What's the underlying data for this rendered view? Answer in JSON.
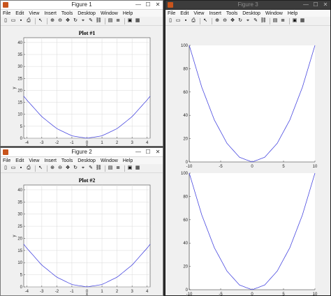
{
  "figure1": {
    "title": "Figure 1",
    "menu": [
      "File",
      "Edit",
      "View",
      "Insert",
      "Tools",
      "Desktop",
      "Window",
      "Help"
    ],
    "plot": {
      "title": "Plot #1",
      "xlabel": "x",
      "ylabel": "y",
      "xticks": [
        "-4",
        "-3",
        "-2",
        "-1",
        "0",
        "1",
        "2",
        "3",
        "4"
      ],
      "yticks": [
        "0",
        "5",
        "10",
        "15",
        "20",
        "25",
        "30",
        "35",
        "40"
      ]
    }
  },
  "figure2": {
    "title": "Figure 2",
    "menu": [
      "File",
      "Edit",
      "View",
      "Insert",
      "Tools",
      "Desktop",
      "Window",
      "Help"
    ],
    "plot": {
      "title": "Plot #2",
      "xlabel": "x",
      "ylabel": "y",
      "xticks": [
        "-4",
        "-3",
        "-2",
        "-1",
        "0",
        "1",
        "2",
        "3",
        "4"
      ],
      "yticks": [
        "0",
        "5",
        "10",
        "15",
        "20",
        "25",
        "30",
        "35",
        "40"
      ]
    }
  },
  "figure3": {
    "title": "Figure 3",
    "menu": [
      "File",
      "Edit",
      "View",
      "Insert",
      "Tools",
      "Desktop",
      "Window",
      "Help"
    ],
    "plots": [
      {
        "xticks": [
          "-10",
          "-5",
          "0",
          "5",
          "10"
        ],
        "yticks": [
          "0",
          "20",
          "40",
          "60",
          "80",
          "100"
        ]
      },
      {
        "xticks": [
          "-10",
          "-5",
          "0",
          "5",
          "10"
        ],
        "yticks": [
          "0",
          "20",
          "40",
          "60",
          "80",
          "100"
        ]
      }
    ]
  },
  "window_controls": {
    "minimize": "—",
    "maximize": "☐",
    "close": "✕"
  },
  "toolbar_icons": [
    "new-file-icon",
    "open-icon",
    "save-icon",
    "print-icon",
    "pointer-icon",
    "zoom-in-icon",
    "zoom-out-icon",
    "pan-icon",
    "rotate-icon",
    "data-cursor-icon",
    "brush-icon",
    "link-icon",
    "colorbar-icon",
    "legend-icon",
    "hide-plot-tools-icon",
    "show-plot-tools-icon"
  ],
  "colors": {
    "line": "#4a4ae0",
    "grid": "#d8d8d8"
  },
  "chart_data": [
    {
      "type": "line",
      "title": "Plot #1",
      "xlabel": "x",
      "ylabel": "y",
      "xlim": [
        -4.2,
        4.2
      ],
      "ylim": [
        0,
        42
      ],
      "grid": true,
      "series": [
        {
          "x": [
            -4.2,
            -4,
            -3,
            -2,
            -1,
            0,
            1,
            2,
            3,
            4,
            4.2
          ],
          "y": [
            17.6,
            16,
            9,
            4,
            1,
            0,
            1,
            4,
            9,
            16,
            17.6
          ]
        }
      ]
    },
    {
      "type": "line",
      "title": "Plot #2",
      "xlabel": "x",
      "ylabel": "y",
      "xlim": [
        -4.2,
        4.2
      ],
      "ylim": [
        0,
        42
      ],
      "grid": true,
      "series": [
        {
          "x": [
            -4.2,
            -4,
            -3,
            -2,
            -1,
            0,
            1,
            2,
            3,
            4,
            4.2
          ],
          "y": [
            17.6,
            16,
            9,
            4,
            1,
            0,
            1,
            4,
            9,
            16,
            17.6
          ]
        }
      ]
    },
    {
      "type": "line",
      "xlim": [
        -10,
        10
      ],
      "ylim": [
        0,
        100
      ],
      "grid": false,
      "series": [
        {
          "x": [
            -10,
            -8,
            -6,
            -4,
            -2,
            0,
            2,
            4,
            6,
            8,
            10
          ],
          "y": [
            100,
            64,
            36,
            16,
            4,
            0,
            4,
            16,
            36,
            64,
            100
          ]
        }
      ]
    },
    {
      "type": "line",
      "xlim": [
        -10,
        10
      ],
      "ylim": [
        0,
        100
      ],
      "grid": false,
      "series": [
        {
          "x": [
            -10,
            -8,
            -6,
            -4,
            -2,
            0,
            2,
            4,
            6,
            8,
            10
          ],
          "y": [
            100,
            64,
            36,
            16,
            4,
            0,
            4,
            16,
            36,
            64,
            100
          ]
        }
      ]
    }
  ]
}
